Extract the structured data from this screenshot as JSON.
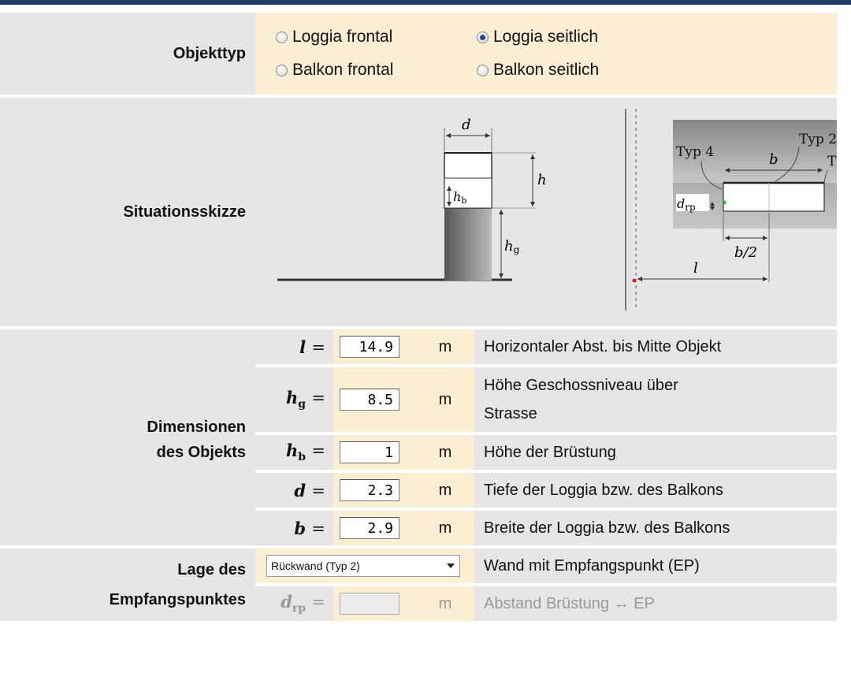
{
  "object_type": {
    "label": "Objekttyp",
    "options": [
      {
        "label": "Loggia frontal",
        "selected": false
      },
      {
        "label": "Loggia seitlich",
        "selected": true
      },
      {
        "label": "Balkon frontal",
        "selected": false
      },
      {
        "label": "Balkon seitlich",
        "selected": false
      }
    ]
  },
  "sketch": {
    "label": "Situationsskizze",
    "front": {
      "d": "d",
      "h": "h",
      "hb": "h",
      "hb_sub": "b",
      "hg": "h",
      "hg_sub": "g"
    },
    "side": {
      "typ4": "Typ 4",
      "b": "b",
      "typ2": "Typ 2",
      "typ3_partial": "Ty",
      "drp": "d",
      "drp_sub": "rp",
      "b2": "b/2",
      "l": "l"
    }
  },
  "dimensions": {
    "label_line1": "Dimensionen",
    "label_line2": "des Objekts",
    "rows": [
      {
        "sym": "l",
        "sub": "",
        "eq": "=",
        "value": "14.9",
        "unit": "m",
        "desc": "Horizontaler Abst. bis Mitte Objekt"
      },
      {
        "sym": "h",
        "sub": "g",
        "eq": "=",
        "value": "8.5",
        "unit": "m",
        "desc_line1": "Höhe Geschossniveau über",
        "desc_line2": "Strasse"
      },
      {
        "sym": "h",
        "sub": "b",
        "eq": "=",
        "value": "1",
        "unit": "m",
        "desc": "Höhe der Brüstung"
      },
      {
        "sym": "d",
        "sub": "",
        "eq": "=",
        "value": "2.3",
        "unit": "m",
        "desc": "Tiefe der Loggia bzw. des Balkons"
      },
      {
        "sym": "b",
        "sub": "",
        "eq": "=",
        "value": "2.9",
        "unit": "m",
        "desc": "Breite der Loggia bzw. des Balkons"
      }
    ]
  },
  "receiver": {
    "label_line1": "Lage des",
    "label_line2": "Empfangspunktes",
    "wall_select": "Rückwand (Typ 2)",
    "wall_desc": "Wand mit Empfangspunkt (EP)",
    "drp_sym": "d",
    "drp_sub": "rp",
    "drp_eq": "=",
    "drp_value": "",
    "drp_unit": "m",
    "drp_desc": "Abstand Brüstung ↔ EP"
  }
}
